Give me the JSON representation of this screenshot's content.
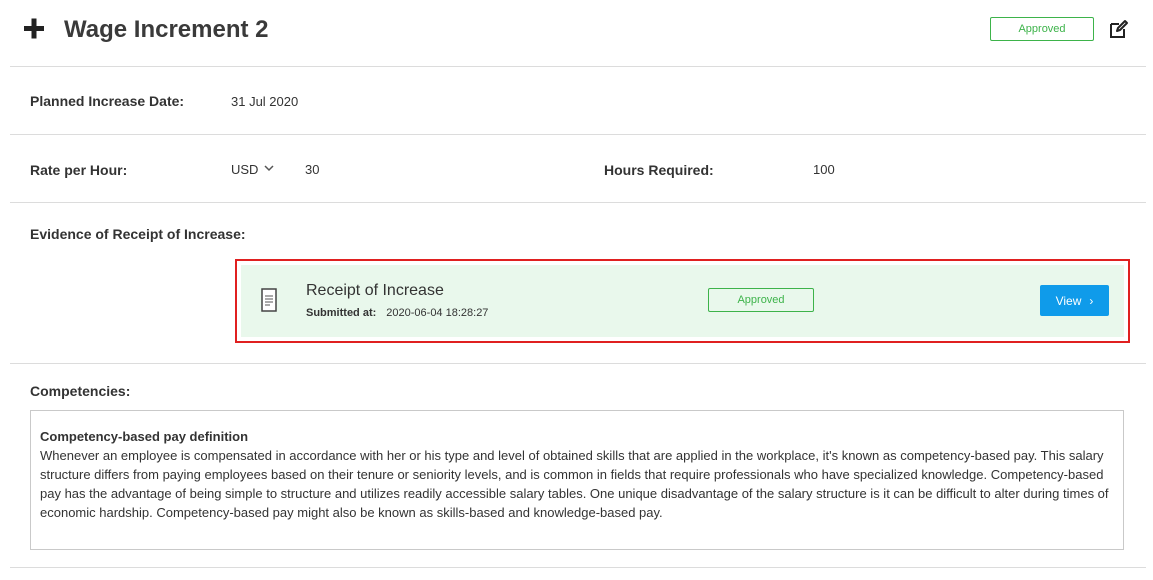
{
  "header": {
    "title": "Wage Increment 2",
    "status": "Approved",
    "plus_icon": "plus-icon",
    "edit_icon": "edit-icon"
  },
  "fields": {
    "planned_increase_date_label": "Planned Increase Date:",
    "planned_increase_date_value": "31 Jul 2020",
    "rate_per_hour_label": "Rate per Hour:",
    "currency": "USD",
    "rate_value": "30",
    "hours_required_label": "Hours Required:",
    "hours_required_value": "100"
  },
  "evidence": {
    "section_label": "Evidence of Receipt of Increase:",
    "item_title": "Receipt of Increase",
    "submitted_label": "Submitted at:",
    "submitted_value": "2020-06-04 18:28:27",
    "status": "Approved",
    "view_label": "View",
    "view_chevron": "›"
  },
  "competencies": {
    "section_label": "Competencies:",
    "title": "Competency-based pay definition",
    "body": "Whenever an employee is compensated in accordance with her or his type and level of obtained skills that are applied in the workplace, it's known as competency-based pay. This salary structure differs from paying employees based on their tenure or seniority levels, and is common in fields that require professionals who have specialized knowledge. Competency-based pay has the advantage of being simple to structure and utilizes readily accessible salary tables. One unique disadvantage of the salary structure is it can be difficult to alter during times of economic hardship. Competency-based pay might also be known as skills-based and knowledge-based pay."
  },
  "colors": {
    "approved_green": "#3db34a",
    "evidence_bg": "#e9f8ec",
    "highlight_red": "#e02020",
    "view_blue": "#0f9bea"
  }
}
